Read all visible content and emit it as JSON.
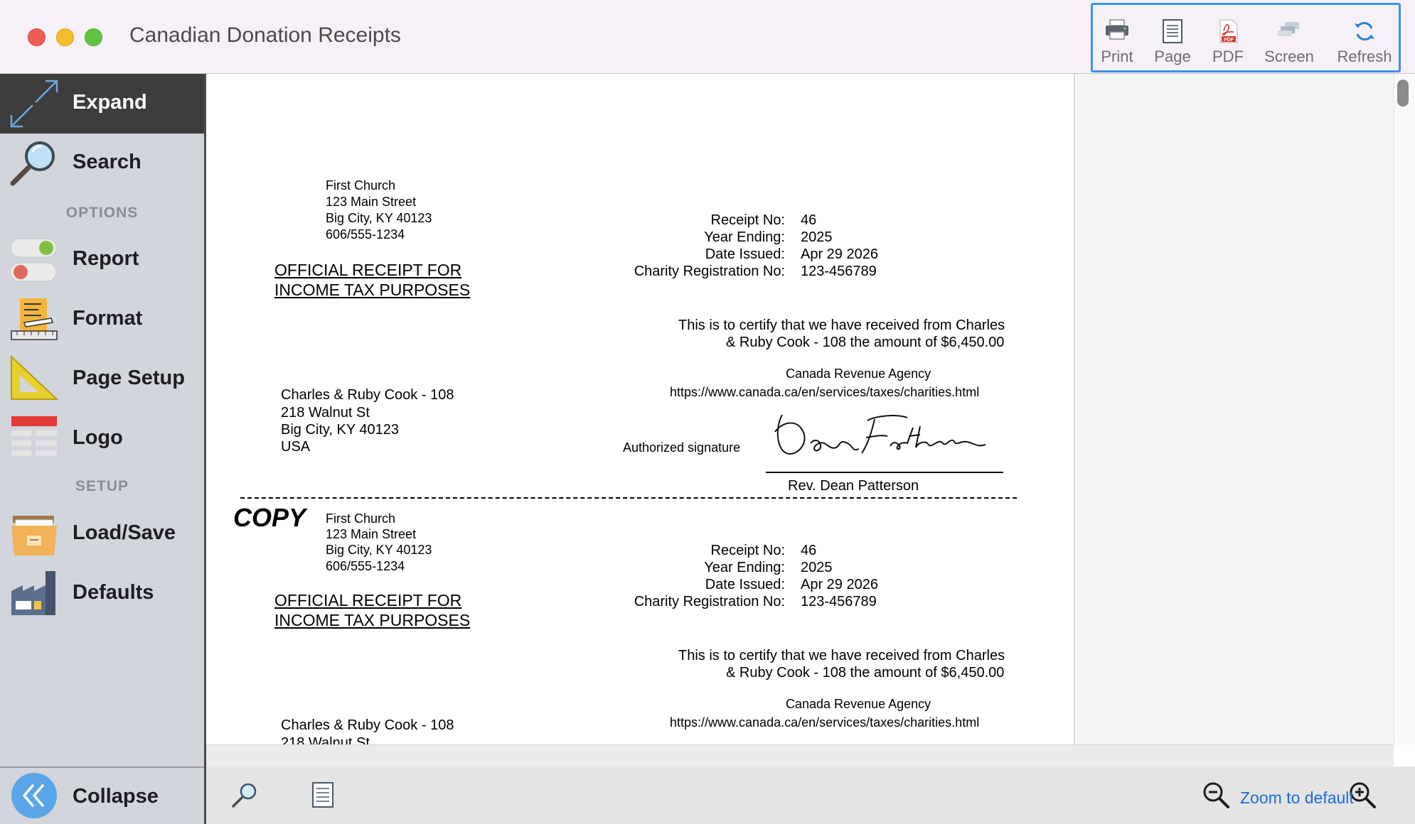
{
  "window": {
    "title": "Canadian Donation Receipts"
  },
  "toolbar": {
    "print": "Print",
    "page": "Page",
    "pdf": "PDF",
    "pdf_icon_text": "PDF",
    "screen": "Screen",
    "refresh": "Refresh"
  },
  "sidebar": {
    "expand": "Expand",
    "search": "Search",
    "options_header": "OPTIONS",
    "report": "Report",
    "format": "Format",
    "page_setup": "Page Setup",
    "logo": "Logo",
    "setup_header": "SETUP",
    "load_save": "Load/Save",
    "defaults": "Defaults",
    "collapse": "Collapse"
  },
  "receipt": {
    "church": {
      "name": "First Church",
      "street": "123 Main Street",
      "city": "Big City, KY  40123",
      "phone": "606/555-1234"
    },
    "heading_line1": "OFFICIAL RECEIPT FOR",
    "heading_line2": "INCOME TAX  PURPOSES",
    "labels": {
      "receipt_no": "Receipt No:",
      "year_ending": "Year Ending:",
      "date_issued": "Date Issued:",
      "charity_reg": "Charity Registration No:"
    },
    "values": {
      "receipt_no": "46",
      "year_ending": "2025",
      "date_issued": "Apr 29 2026",
      "charity_reg": "123-456789"
    },
    "certify_line1": "This is to certify that we have received from Charles",
    "certify_line2": "& Ruby Cook - 108 the amount of $6,450.00",
    "agency": "Canada Revenue Agency",
    "agency_url": "https://www.canada.ca/en/services/taxes/charities.html",
    "donor": {
      "name": "Charles & Ruby Cook - 108",
      "street": "218 Walnut St",
      "city": "Big City, KY 40123",
      "country": "USA"
    },
    "signature_label": "Authorized signature",
    "signature_script": "Dean Patterson",
    "signer": "Rev. Dean Patterson",
    "copy_stamp": "COPY"
  },
  "bottom": {
    "zoom_default": "Zoom to default"
  }
}
